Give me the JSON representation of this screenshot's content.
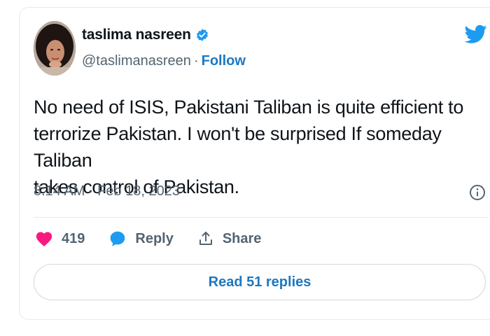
{
  "author": {
    "display_name": "taslima nasreen",
    "handle": "@taslimanasreen",
    "separator": "·",
    "follow_label": "Follow",
    "verified": true
  },
  "tweet": {
    "text": "No need of ISIS, Pakistani Taliban is quite efficient to\nterrorize Pakistan. I won't be surprised If someday  Taliban\ntakes control of Pakistan.",
    "timestamp": "8:14 AM · Feb 18, 2023"
  },
  "actions": {
    "like_count": "419",
    "reply_label": "Reply",
    "share_label": "Share"
  },
  "read_replies_label": "Read 51 replies",
  "icons": {
    "brand": "twitter-bird-icon",
    "verified": "verified-badge-icon",
    "info": "info-icon",
    "like": "heart-icon",
    "reply": "reply-bubble-icon",
    "share": "share-icon"
  },
  "colors": {
    "accent_blue": "#1d9bf0",
    "link_blue": "#1d78c1",
    "like_pink": "#f91880",
    "text_primary": "#0f1419",
    "text_secondary": "#536471",
    "border": "#e6e9eb"
  }
}
